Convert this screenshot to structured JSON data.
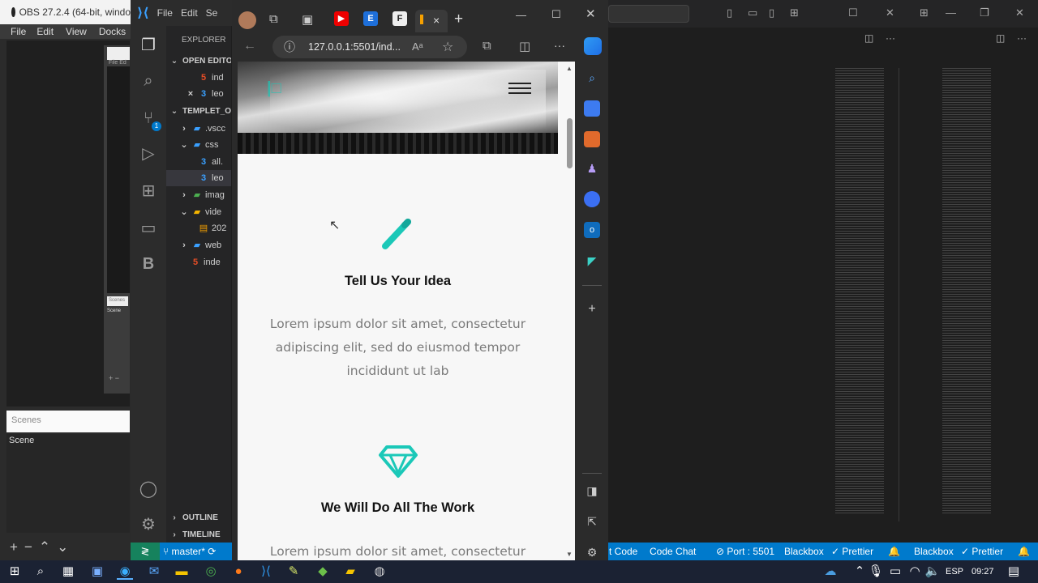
{
  "obs": {
    "title": "OBS 27.2.4 (64-bit, windo",
    "menu": [
      "File",
      "Edit",
      "View",
      "Docks"
    ],
    "mini_menu": [
      "File",
      "Ed"
    ],
    "mini_label": "Scenes",
    "mini_label2": "Scene",
    "scenes_header": "Scenes",
    "scene_item": "Scene",
    "controls": [
      "+",
      "−",
      "⌃",
      "⌄"
    ]
  },
  "vscode": {
    "menu": [
      "File",
      "Edit",
      "Se"
    ],
    "explorer_title": "EXPLORER",
    "open_editors": "OPEN EDITO",
    "open_files": [
      "ind",
      "leo"
    ],
    "project": "TEMPLET_O",
    "tree": [
      {
        "label": ".vscc",
        "icon": "folder-icon",
        "depth": 1
      },
      {
        "label": "css",
        "icon": "folder-icon",
        "depth": 1
      },
      {
        "label": "all.",
        "icon": "css-file-icon",
        "depth": 2
      },
      {
        "label": "leo",
        "icon": "css-file-icon",
        "depth": 2
      },
      {
        "label": "imag",
        "icon": "folder-icon",
        "depth": 1
      },
      {
        "label": "vide",
        "icon": "folder-icon",
        "depth": 1
      },
      {
        "label": "202",
        "icon": "video-file-icon",
        "depth": 2
      },
      {
        "label": "web",
        "icon": "folder-icon",
        "depth": 1
      },
      {
        "label": "inde",
        "icon": "html-file-icon",
        "depth": 1
      }
    ],
    "outline": "OUTLINE",
    "timeline": "TIMELINE",
    "scm_badge": "1",
    "status": {
      "branch": "master*",
      "code": "t Code",
      "code_chat": "Code Chat",
      "port": "Port : 5501",
      "blackbox1": "Blackbox",
      "prettier1": "Prettier",
      "blackbox2": "Blackbox",
      "prettier2": "Prettier"
    }
  },
  "browser": {
    "url": "127.0.0.1:5501/ind...",
    "read_aloud": "A",
    "tabs_close": "×",
    "tabs_new": "+"
  },
  "page": {
    "features": [
      {
        "icon": "pencil-icon",
        "title": "Tell Us Your Idea",
        "text": "Lorem ipsum dolor sit amet, consectetur adipiscing elit, sed do eiusmod tempor incididunt ut lab"
      },
      {
        "icon": "diamond-icon",
        "title": "We Will Do All The Work",
        "text": "Lorem ipsum dolor sit amet, consectetur"
      }
    ],
    "accent": "#1bc8b8"
  },
  "taskbar": {
    "lang": "ESP",
    "time": "09:27"
  }
}
